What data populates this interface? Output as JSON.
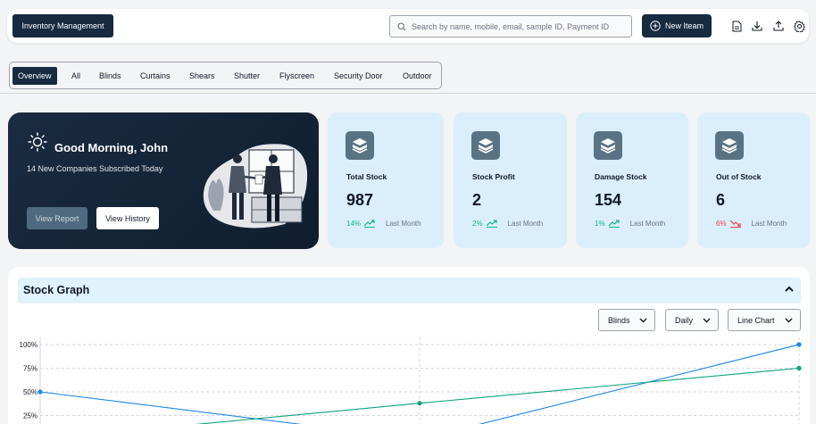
{
  "header": {
    "brand": "Inventory Management",
    "search_placeholder": "Search by name, mobile, email, sample ID, Payment ID",
    "new_button": "New Iteam"
  },
  "tabs": [
    "Overview",
    "All",
    "Blinds",
    "Curtains",
    "Shears",
    "Shutter",
    "Flyscreen",
    "Security Door",
    "Outdoor"
  ],
  "active_tab": "Overview",
  "welcome": {
    "greeting": "Good Morning, John",
    "subtitle": "14 New Companies Subscribed Today",
    "view_report": "View Report",
    "view_history": "View History"
  },
  "stats": [
    {
      "label": "Total Stock",
      "value": "987",
      "pct": "14%",
      "trend": "up",
      "period": "Last Month"
    },
    {
      "label": "Stock Profit",
      "value": "2",
      "pct": "2%",
      "trend": "up",
      "period": "Last Month"
    },
    {
      "label": "Damage Stock",
      "value": "154",
      "pct": "1%",
      "trend": "up",
      "period": "Last Month"
    },
    {
      "label": "Out of Stock",
      "value": "6",
      "pct": "6%",
      "trend": "down",
      "period": "Last Month"
    }
  ],
  "graph": {
    "title": "Stock Graph",
    "filters": {
      "product": "Blinds",
      "range": "Daily",
      "type": "Line Chart"
    }
  },
  "colors": {
    "dark": "#162a40",
    "card": "#dbeefb",
    "blue_series": "#1e88e5",
    "green_series": "#10a37f"
  },
  "chart_data": {
    "type": "line",
    "y_ticks": [
      "100%",
      "75%",
      "50%",
      "25%"
    ],
    "ylim": [
      0,
      100
    ],
    "x_points": 3,
    "series": [
      {
        "values": [
          50,
          0,
          100
        ],
        "color": "#1e88e5"
      },
      {
        "values": [
          0,
          38,
          75
        ],
        "color": "#10a37f"
      }
    ]
  }
}
